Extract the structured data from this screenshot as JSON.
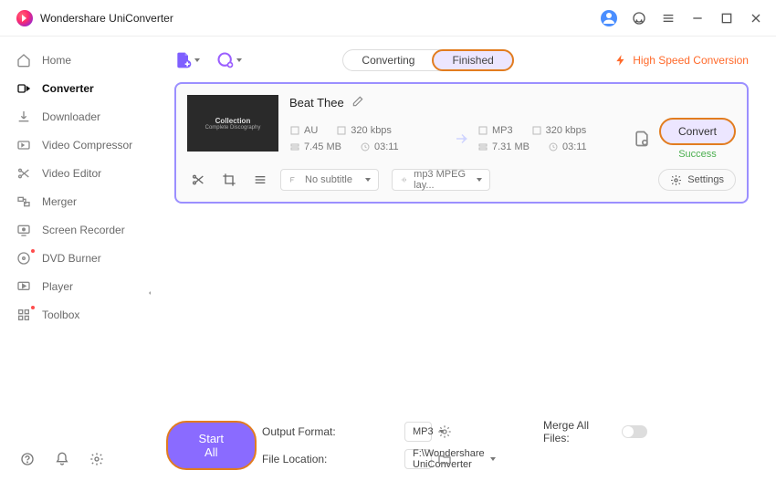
{
  "app": {
    "title": "Wondershare UniConverter"
  },
  "sidebar": {
    "items": [
      {
        "label": "Home",
        "icon": "home"
      },
      {
        "label": "Converter",
        "icon": "converter"
      },
      {
        "label": "Downloader",
        "icon": "downloader"
      },
      {
        "label": "Video Compressor",
        "icon": "compressor"
      },
      {
        "label": "Video Editor",
        "icon": "editor"
      },
      {
        "label": "Merger",
        "icon": "merger"
      },
      {
        "label": "Screen Recorder",
        "icon": "recorder"
      },
      {
        "label": "DVD Burner",
        "icon": "dvd"
      },
      {
        "label": "Player",
        "icon": "player"
      },
      {
        "label": "Toolbox",
        "icon": "toolbox"
      }
    ],
    "active_index": 1
  },
  "tabs": {
    "items": [
      "Converting",
      "Finished"
    ],
    "active_index": 1
  },
  "high_speed": "High Speed Conversion",
  "task": {
    "title": "Beat Thee",
    "thumb_title": "Collection",
    "thumb_sub": "Complete Discography",
    "src": {
      "fmt": "AU",
      "bitrate": "320 kbps",
      "size": "7.45 MB",
      "dur": "03:11"
    },
    "dst": {
      "fmt": "MP3",
      "bitrate": "320 kbps",
      "size": "7.31 MB",
      "dur": "03:11"
    },
    "subtitle_sel": "No subtitle",
    "audio_sel": "mp3 MPEG lay...",
    "settings_label": "Settings",
    "convert_label": "Convert",
    "status": "Success"
  },
  "footer": {
    "out_fmt_label": "Output Format:",
    "out_fmt_value": "MP3",
    "file_loc_label": "File Location:",
    "file_loc_value": "F:\\Wondershare UniConverter",
    "merge_label": "Merge All Files:",
    "start_all": "Start All"
  }
}
